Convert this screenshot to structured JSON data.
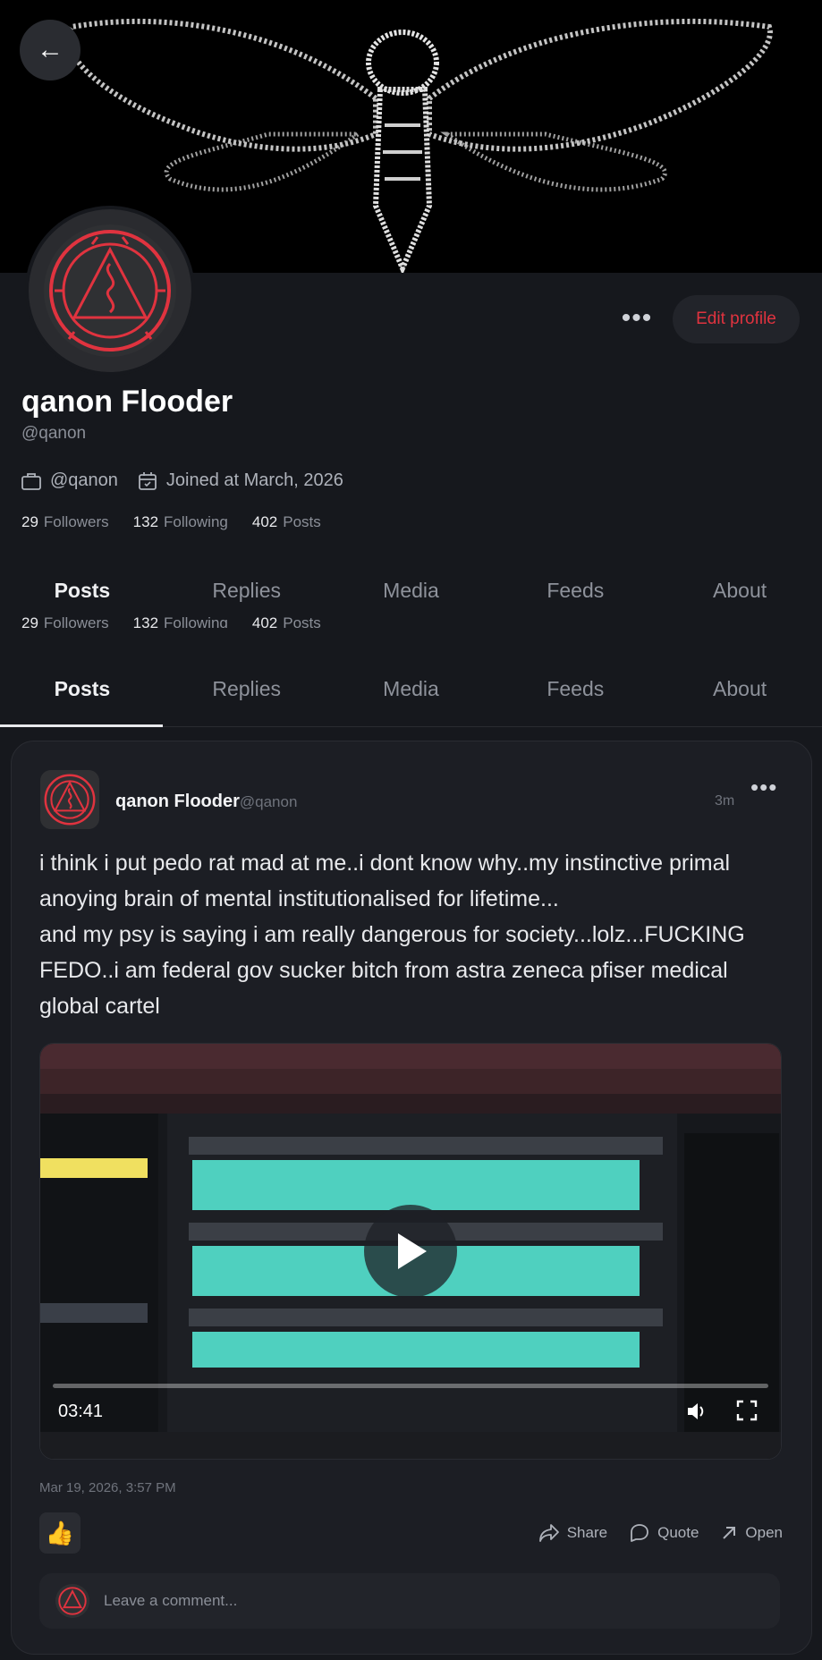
{
  "profile": {
    "display_name": "qanon Flooder",
    "handle": "@qanon",
    "website": "@qanon",
    "joined": "Joined at March, 2026",
    "edit_label": "Edit profile",
    "more_label": "•••",
    "stats": {
      "followers_count": "29",
      "followers_label": "Followers",
      "following_count": "132",
      "following_label": "Following",
      "posts_count": "402",
      "posts_label": "Posts"
    }
  },
  "tabs": [
    {
      "label": "Posts",
      "active": true
    },
    {
      "label": "Replies"
    },
    {
      "label": "Media"
    },
    {
      "label": "Feeds"
    },
    {
      "label": "About"
    }
  ],
  "post": {
    "author": "qanon Flooder",
    "handle": "@qanon",
    "time": "3m",
    "more_label": "•••",
    "text_lines": [
      "i think i put pedo rat mad at me..i dont know why..my instinctive primal anoying brain of mental institutionalised for lifetime...",
      "and my psy is saying i am really dangerous for society...lolz...FUCKING FEDO..i am federal gov sucker bitch from astra zeneca pfiser medical global cartel"
    ],
    "video": {
      "duration": "03:41",
      "progress": 0
    },
    "date": "Mar 19, 2026, 3:57 PM",
    "like_emoji": "👍",
    "actions": {
      "share": "Share",
      "quote": "Quote",
      "open": "Open"
    },
    "comment_placeholder": "Leave a comment..."
  },
  "colors": {
    "accent": "#e0333f",
    "background": "#16181d",
    "card": "#1c1e24"
  },
  "icons": [
    "back-arrow-icon",
    "briefcase-icon",
    "calendar-icon",
    "play-icon",
    "volume-icon",
    "fullscreen-icon",
    "share-icon",
    "quote-icon",
    "open-arrow-icon"
  ]
}
